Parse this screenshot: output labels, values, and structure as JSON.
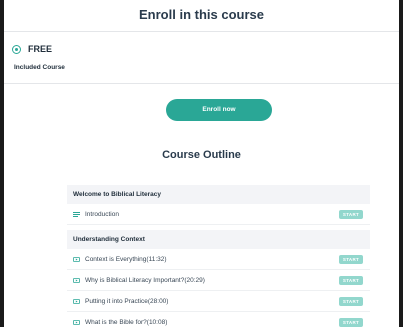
{
  "header": {
    "title": "Enroll in this course"
  },
  "pricing": {
    "option_label": "FREE",
    "option_sub": "Included Course",
    "selected": true
  },
  "enroll_button_label": "Enroll now",
  "outline": {
    "title": "Course Outline",
    "start_label": "START",
    "sections": [
      {
        "title": "Welcome to Biblical Literacy",
        "lessons": [
          {
            "title": "Introduction",
            "icon": "text-icon"
          }
        ]
      },
      {
        "title": "Understanding Context",
        "lessons": [
          {
            "title": "Context is Everything(11:32)",
            "icon": "video-icon"
          },
          {
            "title": "Why is Biblical Literacy Important?(20:29)",
            "icon": "video-icon"
          },
          {
            "title": "Putting it into Practice(28:00)",
            "icon": "video-icon"
          },
          {
            "title": "What is the Bible for?(10:08)",
            "icon": "video-icon"
          }
        ]
      }
    ]
  },
  "colors": {
    "accent": "#2aa796",
    "start_badge": "#92d7cd",
    "section_bg": "#f3f4f7"
  }
}
